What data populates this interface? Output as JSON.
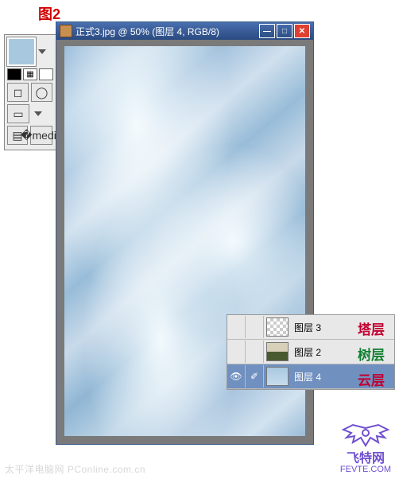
{
  "figure_label": "图2",
  "document": {
    "title": "正式3.jpg @ 50% (图层 4, RGB/8)"
  },
  "tool_options": {
    "swatch_color": "#a8c8e0"
  },
  "layers": {
    "rows": [
      {
        "name": "图层 3",
        "visible": false,
        "selected": false,
        "thumb": "trans"
      },
      {
        "name": "图层 2",
        "visible": false,
        "selected": false,
        "thumb": "tree"
      },
      {
        "name": "图层 4",
        "visible": true,
        "selected": true,
        "thumb": "sky"
      }
    ]
  },
  "annotations": {
    "tower": "塔层",
    "tree": "树层",
    "cloud": "云层"
  },
  "watermark": "太平洋电脑网 PConline.com.cn",
  "site": {
    "name": "飞特网",
    "url": "FEVTE.COM"
  }
}
